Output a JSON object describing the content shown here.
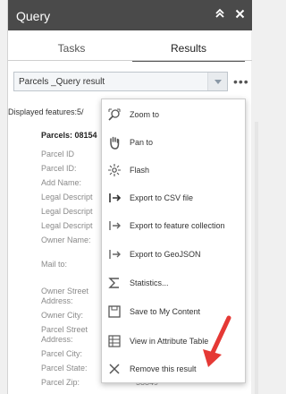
{
  "panel": {
    "title": "Query",
    "collapse_icon": "double-chevron-up-icon",
    "close_icon": "close-icon"
  },
  "tabs": [
    {
      "label": "Tasks",
      "active": false
    },
    {
      "label": "Results",
      "active": true
    }
  ],
  "result_select": {
    "value": "Parcels _Query result"
  },
  "more_label": "•••",
  "displayed_features": "Displayed features:5/",
  "result_header": "Parcels: 08154",
  "attributes": [
    {
      "label": "Parcel ID",
      "value": ""
    },
    {
      "label": "Parcel ID:",
      "value": ""
    },
    {
      "label": "Add Name:",
      "value": ""
    },
    {
      "label": "Legal Descript",
      "value": ""
    },
    {
      "label": "Legal Descript",
      "value": ""
    },
    {
      "label": "Legal Descript",
      "value": ""
    },
    {
      "label": "Owner Name:",
      "value": ""
    },
    {
      "label": "Mail to:",
      "value": ""
    },
    {
      "label": "Owner Street Address:",
      "value": ""
    },
    {
      "label": "Owner City:",
      "value": ""
    },
    {
      "label": "Parcel Street Address:",
      "value": ""
    },
    {
      "label": "Parcel City:",
      "value": ""
    },
    {
      "label": "Parcel State:",
      "value": ""
    },
    {
      "label": "Parcel Zip:",
      "value": "58849"
    }
  ],
  "menu": [
    {
      "label": "Zoom to",
      "icon": "zoom-to-icon"
    },
    {
      "label": "Pan to",
      "icon": "pan-hand-icon"
    },
    {
      "label": "Flash",
      "icon": "flash-icon"
    },
    {
      "label": "Export to CSV file",
      "icon": "export-icon"
    },
    {
      "label": "Export to feature collection",
      "icon": "export-icon"
    },
    {
      "label": "Export to GeoJSON",
      "icon": "export-icon"
    },
    {
      "label": "Statistics...",
      "icon": "sigma-icon"
    },
    {
      "label": "Save to My Content",
      "icon": "save-icon"
    },
    {
      "label": "View in Attribute Table",
      "icon": "table-icon"
    },
    {
      "label": "Remove this result",
      "icon": "close-icon"
    }
  ],
  "colors": {
    "titlebar": "#4a4a4a",
    "annotation_arrow": "#e53935"
  }
}
